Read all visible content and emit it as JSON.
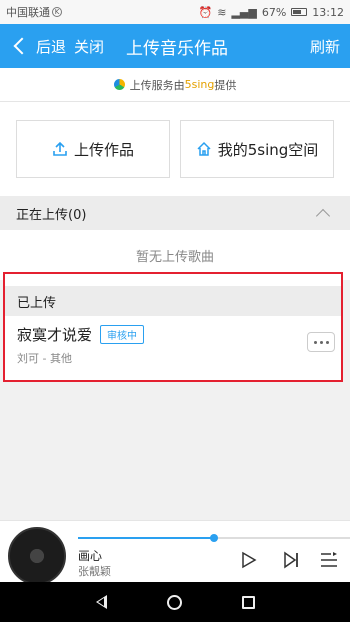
{
  "status_bar": {
    "carrier": "中国联通",
    "carrier_badge": "K",
    "battery": "67%",
    "time": "13:12"
  },
  "nav": {
    "back_label": "后退",
    "close_label": "关闭",
    "title": "上传音乐作品",
    "refresh_label": "刷新"
  },
  "notice": {
    "prefix": "上传服务由",
    "brand": "5sing",
    "suffix": "提供"
  },
  "actions": {
    "upload_label": "上传作品",
    "space_label": "我的5sing空间"
  },
  "uploading": {
    "header": "正在上传(0)",
    "empty_text": "暂无上传歌曲"
  },
  "uploaded": {
    "header": "已上传",
    "items": [
      {
        "title": "寂寞才说爱",
        "status": "审核中",
        "meta": "刘可 - 其他"
      }
    ]
  },
  "player": {
    "track_name": "画心",
    "artist": "张靓颖",
    "progress": 0.5
  },
  "colors": {
    "accent": "#2aa0f0",
    "highlight_border": "#e42030",
    "brand_yellow": "#e4a100"
  }
}
